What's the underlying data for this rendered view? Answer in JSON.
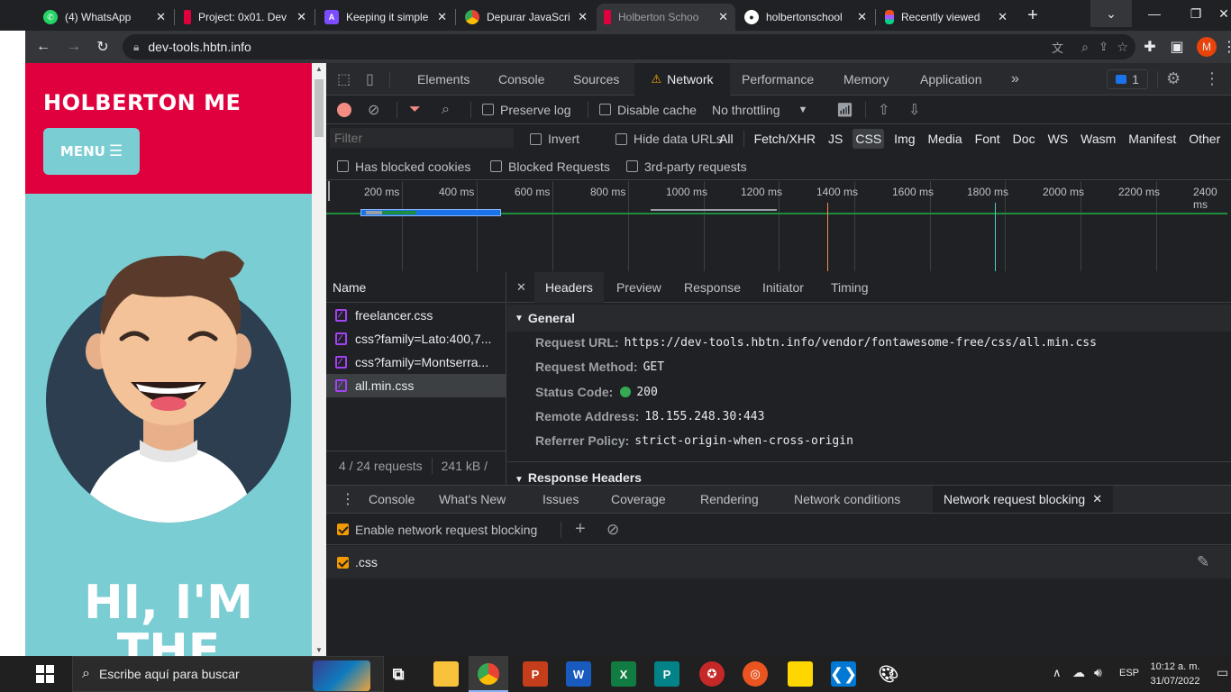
{
  "tabs": [
    {
      "title": "(4) WhatsApp",
      "icon": "whatsapp-icon",
      "color": "#25d366"
    },
    {
      "title": "Project: 0x01. Dev",
      "icon": "holberton-icon",
      "color": "#e0003e"
    },
    {
      "title": "Keeping it simple",
      "icon": "app-icon",
      "color": "#7c4dff"
    },
    {
      "title": "Depurar JavaScri",
      "icon": "chrome-icon",
      "color": "#4285f4"
    },
    {
      "title": "Holberton Schoo",
      "icon": "holberton-icon",
      "color": "#e0003e"
    },
    {
      "title": "holbertonschool",
      "icon": "github-icon",
      "color": "#ffffff"
    },
    {
      "title": "Recently viewed",
      "icon": "figma-icon",
      "color": "#f24e1e"
    }
  ],
  "toolbar": {
    "url": "dev-tools.hbtn.info",
    "profile_initial": "M"
  },
  "page": {
    "brand": "HOLBERTON ME",
    "menu": "MENU",
    "hero_line1": "HI, I'M",
    "hero_line2": "THE"
  },
  "devtools": {
    "main_tabs": [
      "Elements",
      "Console",
      "Sources",
      "Network",
      "Performance",
      "Memory",
      "Application"
    ],
    "active_tab": "Network",
    "issues_count": "1",
    "preserve_log": "Preserve log",
    "disable_cache": "Disable cache",
    "throttling": "No throttling",
    "filter_placeholder": "Filter",
    "invert": "Invert",
    "hide_data_urls": "Hide data URLs",
    "type_filters": [
      "All",
      "Fetch/XHR",
      "JS",
      "CSS",
      "Img",
      "Media",
      "Font",
      "Doc",
      "WS",
      "Wasm",
      "Manifest",
      "Other"
    ],
    "active_type": "CSS",
    "blocked_cookies": "Has blocked cookies",
    "blocked_requests": "Blocked Requests",
    "third_party": "3rd-party requests",
    "timeline_ticks": [
      "200 ms",
      "400 ms",
      "600 ms",
      "800 ms",
      "1000 ms",
      "1200 ms",
      "1400 ms",
      "1600 ms",
      "1800 ms",
      "2000 ms",
      "2200 ms",
      "2400 ms"
    ],
    "name_header": "Name",
    "requests": [
      "freelancer.css",
      "css?family=Lato:400,7...",
      "css?family=Montserra...",
      "all.min.css"
    ],
    "selected_request": 3,
    "summary_requests": "4 / 24 requests",
    "summary_size": "241 kB /",
    "detail_tabs": [
      "Headers",
      "Preview",
      "Response",
      "Initiator",
      "Timing"
    ],
    "active_detail": "Headers",
    "general_title": "General",
    "general": [
      {
        "key": "Request URL:",
        "value": "https://dev-tools.hbtn.info/vendor/fontawesome-free/css/all.min.css"
      },
      {
        "key": "Request Method:",
        "value": "GET"
      },
      {
        "key": "Status Code:",
        "value": "200"
      },
      {
        "key": "Remote Address:",
        "value": "18.155.248.30:443"
      },
      {
        "key": "Referrer Policy:",
        "value": "strict-origin-when-cross-origin"
      }
    ],
    "response_headers_title": "Response Headers",
    "drawer_tabs": [
      "Console",
      "What's New",
      "Issues",
      "Coverage",
      "Rendering",
      "Network conditions",
      "Network request blocking"
    ],
    "active_drawer": "Network request blocking",
    "enable_blocking": "Enable network request blocking",
    "blocked_pattern": ".css"
  },
  "taskbar": {
    "search_placeholder": "Escribe aquí para buscar",
    "lang": "ESP",
    "time": "10:12 a. m.",
    "date": "31/07/2022"
  },
  "colors": {
    "brand_red": "#e0003e",
    "teal": "#7bcdd4",
    "accent_orange": "#f29900",
    "bar_blue": "#1a73e8",
    "bar_green": "#1e8e3e"
  }
}
